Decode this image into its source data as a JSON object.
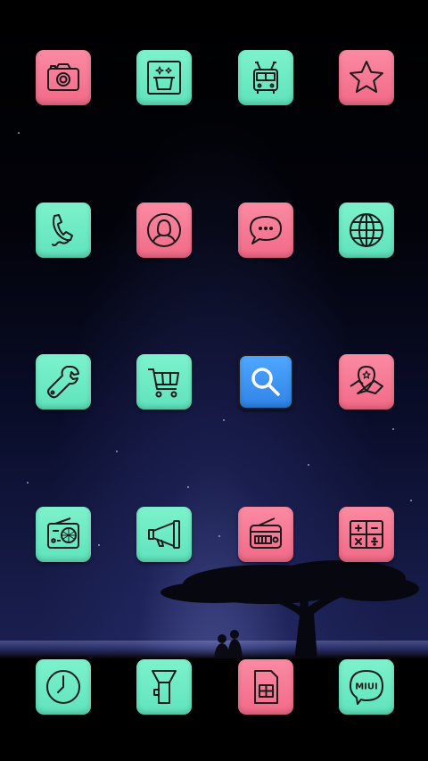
{
  "colors": {
    "mint": "#6aebc4",
    "pink": "#f67a95",
    "blue": "#3d95f2",
    "stroke": "#1a1a1a"
  },
  "home_screen": {
    "rows": [
      [
        "camera-icon",
        "magic-hat-icon",
        "trolleybus-icon",
        "star-icon"
      ],
      [
        "phone-icon",
        "contact-person-icon",
        "message-bubble-icon",
        "globe-icon"
      ],
      [
        "wrench-icon",
        "shopping-cart-icon",
        "search-icon",
        "map-pin-icon"
      ],
      [
        "radio-icon",
        "megaphone-icon",
        "fm-radio-icon",
        "calculator-icon"
      ],
      [
        "clock-icon",
        "flashlight-icon",
        "sim-card-icon",
        "miui-bubble-icon"
      ]
    ],
    "miui_label": "MIUI"
  }
}
